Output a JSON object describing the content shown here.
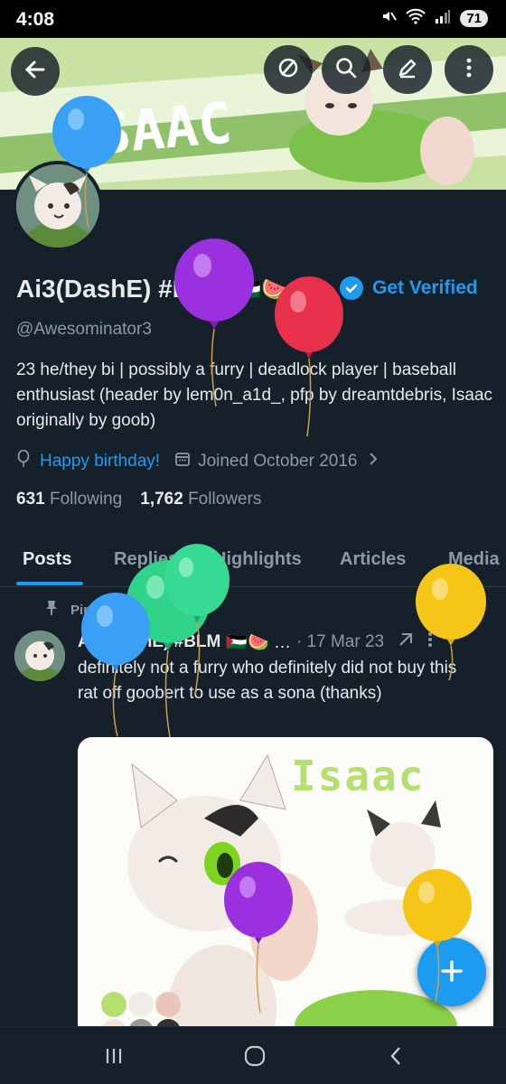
{
  "status_bar": {
    "time": "4:08",
    "battery": "71",
    "wifi_label": "5"
  },
  "profile": {
    "display_name": "Ai3(DashE) #BLM",
    "name_emoji": "🇵🇸🍉",
    "get_verified": "Get Verified",
    "handle": "@Awesominator3",
    "bio": "23 he/they bi | possibly a furry | deadlock player | baseball enthusiast   (header by lem0n_a1d_, pfp by dreamtdebris, Isaac originally by goob)",
    "birthday": "Happy birthday!",
    "joined": "Joined October 2016",
    "following_count": "631",
    "following_label": "Following",
    "followers_count": "1,762",
    "followers_label": "Followers",
    "banner_text": "ISAAC"
  },
  "tabs": [
    {
      "label": "Posts",
      "active": true
    },
    {
      "label": "Replies",
      "active": false
    },
    {
      "label": "Highlights",
      "active": false
    },
    {
      "label": "Articles",
      "active": false
    },
    {
      "label": "Media",
      "active": false
    }
  ],
  "pinned_post": {
    "pinned_label": "Pinned",
    "author": "Ai3(DashE) #BLM",
    "author_emoji": "🇵🇸🍉 …",
    "date": "· 17 Mar 23",
    "text": "definitely not a furry who definitely did not buy this rat off goobert to use as a sona (thanks)",
    "image_title": "Isaac"
  },
  "colors": {
    "background": "#15202b",
    "accent": "#1d9bf0",
    "muted": "#8b98a5",
    "balloon_blue": "#3aa0f5",
    "balloon_purple": "#9b30e0",
    "balloon_red": "#e8304a",
    "balloon_green": "#2fd48a",
    "balloon_yellow": "#f5c518"
  },
  "icons": {
    "back": "arrow-left-icon",
    "hide": "eye-slash-icon",
    "search": "search-icon",
    "edit": "pencil-icon",
    "more": "more-vertical-icon",
    "compose": "plus-icon"
  }
}
